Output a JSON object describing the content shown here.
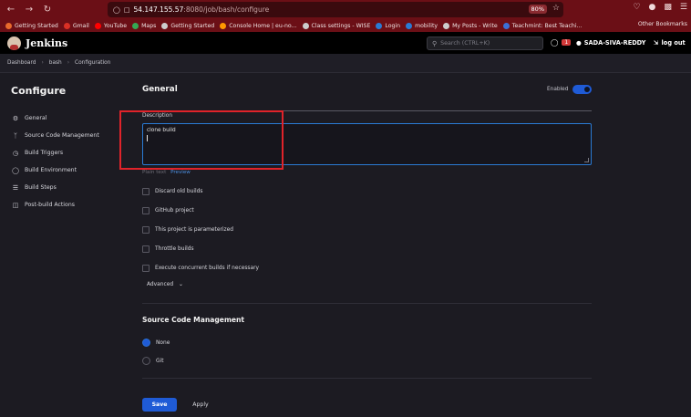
{
  "browser": {
    "url_host": "54.147.155.57",
    "url_path": ":8080/job/bash/configure",
    "zoom": "80%",
    "bookmarks": [
      {
        "label": "Getting Started",
        "icon": "firefox-icon",
        "color": "#e86a2c"
      },
      {
        "label": "Gmail",
        "icon": "gmail-icon",
        "color": "#d93025"
      },
      {
        "label": "YouTube",
        "icon": "youtube-icon",
        "color": "#ff0000"
      },
      {
        "label": "Maps",
        "icon": "maps-icon",
        "color": "#34a853"
      },
      {
        "label": "Getting Started",
        "icon": "globe-icon",
        "color": "#cccccc"
      },
      {
        "label": "Console Home | eu-no...",
        "icon": "aws-icon",
        "color": "#ff9900"
      },
      {
        "label": "Class settings - WISE",
        "icon": "globe-icon",
        "color": "#cccccc"
      },
      {
        "label": "Login",
        "icon": "login-icon",
        "color": "#2a7bd4"
      },
      {
        "label": "mobility",
        "icon": "mobility-icon",
        "color": "#2a7bd4"
      },
      {
        "label": "My Posts - Write",
        "icon": "posts-icon",
        "color": "#cccccc"
      },
      {
        "label": "Teachmint: Best Teachi...",
        "icon": "teachmint-icon",
        "color": "#3b6fd6"
      }
    ],
    "other_bookmarks": "Other Bookmarks"
  },
  "header": {
    "brand": "Jenkins",
    "search_placeholder": "Search (CTRL+K)",
    "notification_count": "1",
    "user": "SADA-SIVA-REDDY",
    "logout": "log out"
  },
  "breadcrumb": [
    "Dashboard",
    "bash",
    "Configuration"
  ],
  "sidebar": {
    "title": "Configure",
    "items": [
      {
        "label": "General",
        "icon": "gear-icon"
      },
      {
        "label": "Source Code Management",
        "icon": "branch-icon"
      },
      {
        "label": "Build Triggers",
        "icon": "clock-icon"
      },
      {
        "label": "Build Environment",
        "icon": "globe-icon"
      },
      {
        "label": "Build Steps",
        "icon": "list-icon"
      },
      {
        "label": "Post-build Actions",
        "icon": "cube-icon"
      }
    ]
  },
  "general": {
    "title": "General",
    "enabled_label": "Enabled",
    "enabled": true,
    "description_label": "Description",
    "description_value": "clone build",
    "plain_text": "Plain text",
    "preview": "Preview",
    "checkboxes": [
      {
        "label": "Discard old builds",
        "checked": false
      },
      {
        "label": "GitHub project",
        "checked": false
      },
      {
        "label": "This project is parameterized",
        "checked": false
      },
      {
        "label": "Throttle builds",
        "checked": false
      },
      {
        "label": "Execute concurrent builds if necessary",
        "checked": false
      }
    ],
    "advanced": "Advanced"
  },
  "scm": {
    "title": "Source Code Management",
    "options": [
      {
        "label": "None",
        "selected": true
      },
      {
        "label": "Git",
        "selected": false
      }
    ]
  },
  "actions": {
    "save": "Save",
    "apply": "Apply"
  },
  "colors": {
    "accent": "#1f5bd6",
    "highlight_box": "#e0232a",
    "browser_chrome": "#6b0f16"
  }
}
